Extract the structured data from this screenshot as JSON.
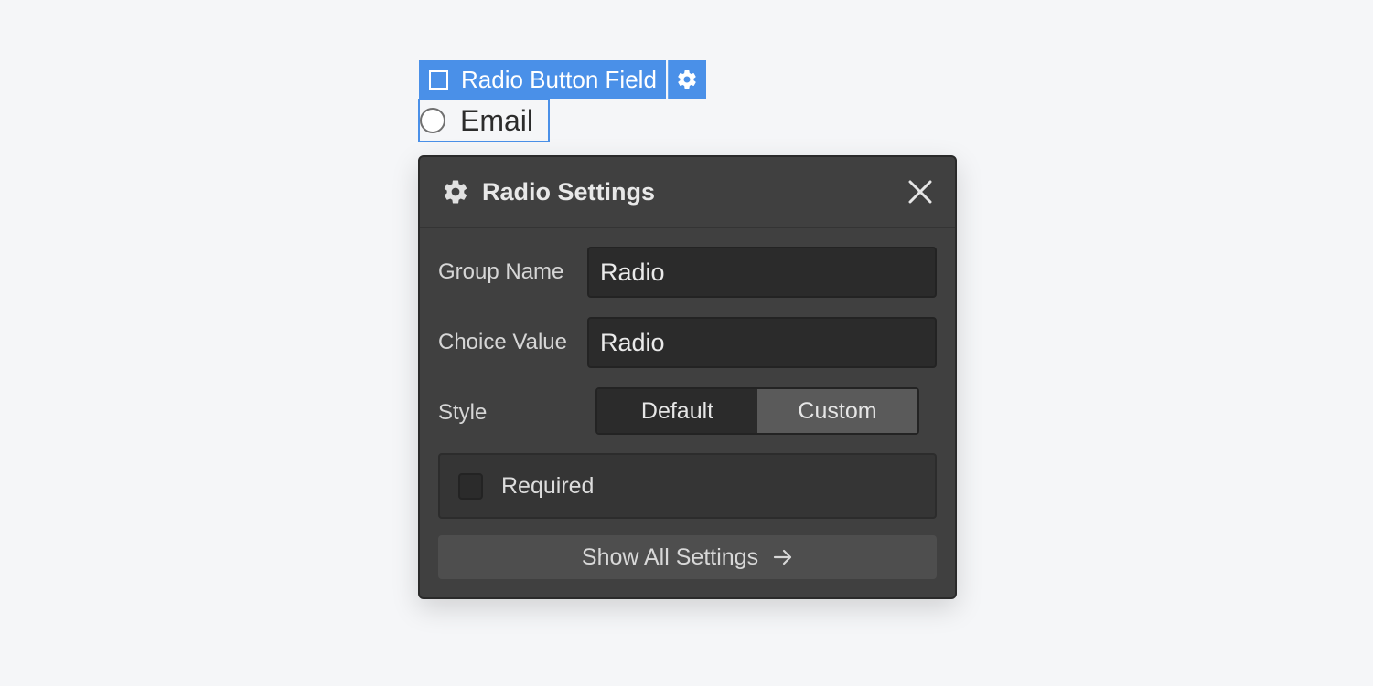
{
  "element_badge": {
    "label": "Radio Button Field",
    "type_icon": "checkbox-square-icon",
    "settings_icon": "gear-icon"
  },
  "radio_element": {
    "label": "Email",
    "icon": "radio-circle-icon"
  },
  "panel": {
    "title": "Radio Settings",
    "title_icon": "gear-icon",
    "close_icon": "close-icon",
    "fields": {
      "group_name": {
        "label": "Group Name",
        "value": "Radio"
      },
      "choice_value": {
        "label": "Choice Value",
        "value": "Radio"
      },
      "style": {
        "label": "Style",
        "options": [
          "Default",
          "Custom"
        ],
        "selected": "Custom"
      },
      "required": {
        "label": "Required",
        "checked": false
      }
    },
    "show_all_button": {
      "label": "Show All Settings",
      "icon": "arrow-right-icon"
    }
  },
  "colors": {
    "accent": "#4a90e8",
    "panel_bg": "#404040",
    "input_bg": "#2b2b2b",
    "page_bg": "#f5f6f8"
  }
}
